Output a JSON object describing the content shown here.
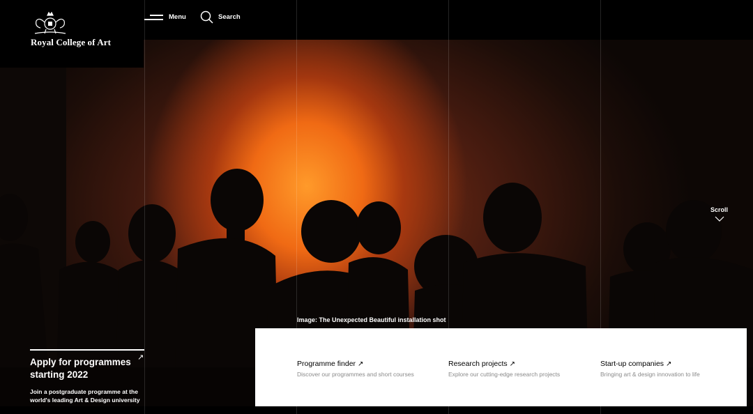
{
  "header": {
    "logo_text": "Royal College of Art",
    "menu_label": "Menu",
    "search_label": "Search"
  },
  "icons": {
    "crest": "crest-icon",
    "menu": "hamburger-icon",
    "search": "search-icon",
    "scroll": "chevron-down-icon",
    "arrow": "arrow-up-right-icon"
  },
  "hero": {
    "caption": "Image: The Unexpected Beautiful installation shot",
    "scroll_label": "Scroll"
  },
  "apply": {
    "title": "Apply for programmes starting 2022",
    "arrow": "↗",
    "description": "Join a postgraduate programme at the world's leading Art & Design university"
  },
  "links": [
    {
      "title": "Programme finder",
      "arrow": "↗",
      "description": "Discover our programmes and short courses"
    },
    {
      "title": "Research projects",
      "arrow": "↗",
      "description": "Explore our cutting-edge research projects"
    },
    {
      "title": "Start-up companies",
      "arrow": "↗",
      "description": "Bringing art & design innovation to life"
    }
  ],
  "colors": {
    "background": "#000000",
    "panel": "#ffffff",
    "glow": "#f06a14",
    "muted_text": "#8a8a8a"
  }
}
